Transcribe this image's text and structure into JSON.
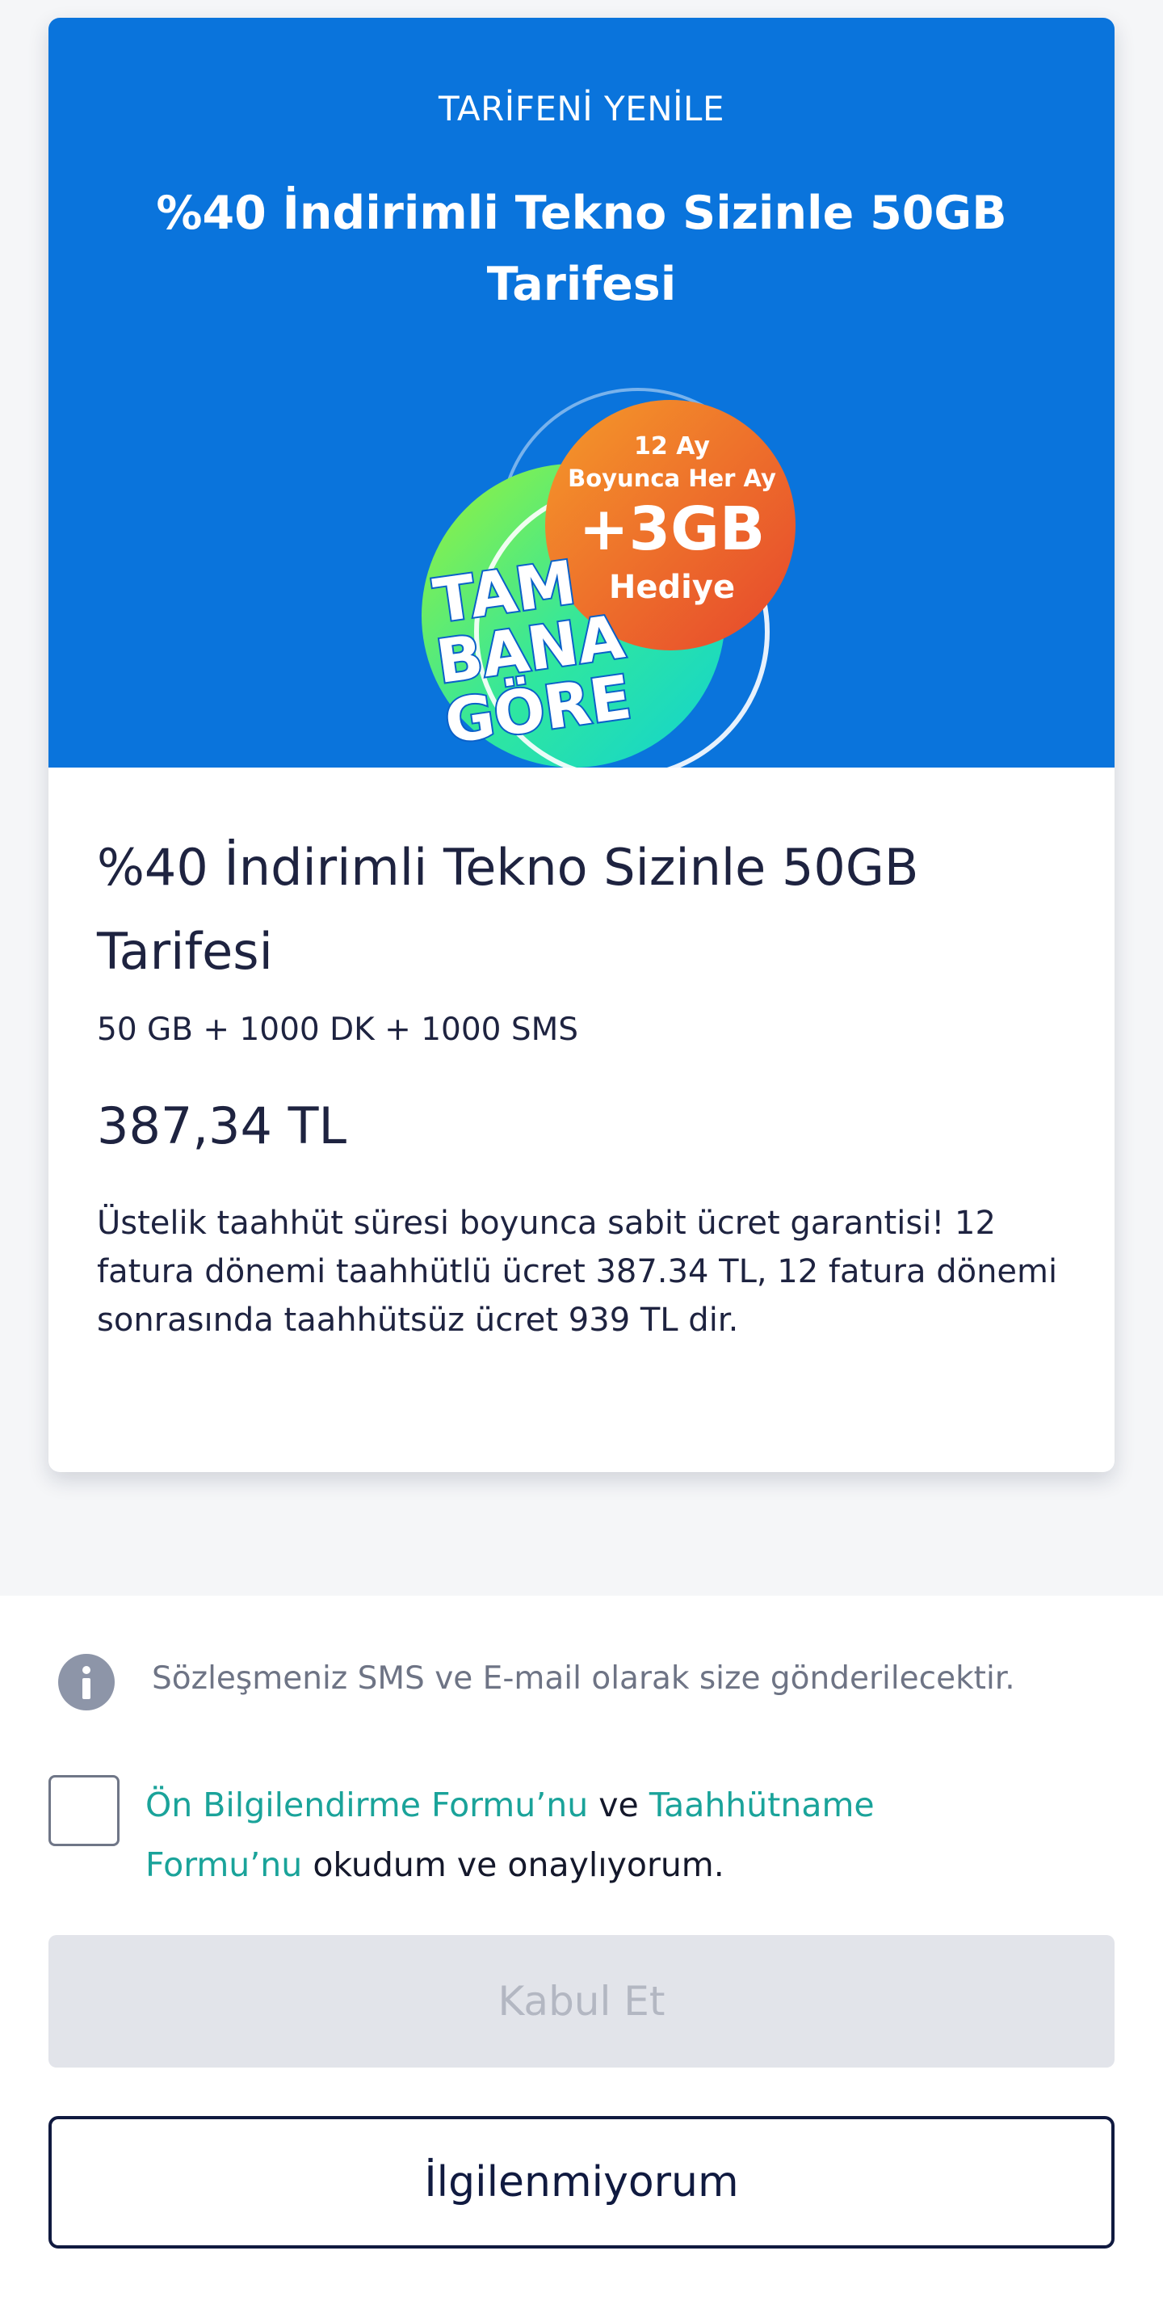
{
  "banner": {
    "eyebrow": "TARİFENİ YENİLE",
    "title": "%40 İndirimli Tekno Sizinle 50GB Tarifesi",
    "promo": {
      "line1": "12 Ay",
      "line2": "Boyunca Her Ay",
      "amount": "+3GB",
      "gift": "Hediye",
      "slogan_1": "TAM",
      "slogan_2": "BANA",
      "slogan_3": "GÖRE"
    }
  },
  "plan": {
    "title": "%40 İndirimli Tekno Sizinle 50GB Tarifesi",
    "features": "50 GB + 1000 DK + 1000 SMS",
    "price": "387,34 TL",
    "description": "Üstelik taahhüt süresi boyunca sabit ücret garantisi! 12 fatura dönemi taahhütlü ücret 387.34 TL, 12 fatura dönemi sonrasında taahhütsüz ücret 939 TL dir."
  },
  "info": {
    "text": "Sözleşmeniz SMS ve E-mail olarak size gönderilecektir."
  },
  "consent": {
    "checked": false,
    "link1": "Ön Bilgilendirme Formu’nu",
    "connector": " ve ",
    "link2": "Taahhütname Formu’nu",
    "suffix": " okudum ve onaylıyorum."
  },
  "buttons": {
    "accept": "Kabul Et",
    "decline": "İlgilenmiyorum"
  },
  "colors": {
    "banner_blue": "#0a74dc",
    "link_teal": "#1aa39a",
    "text_dark": "#1e2340",
    "button_disabled": "#e2e4ea",
    "button_outline": "#101a40"
  }
}
